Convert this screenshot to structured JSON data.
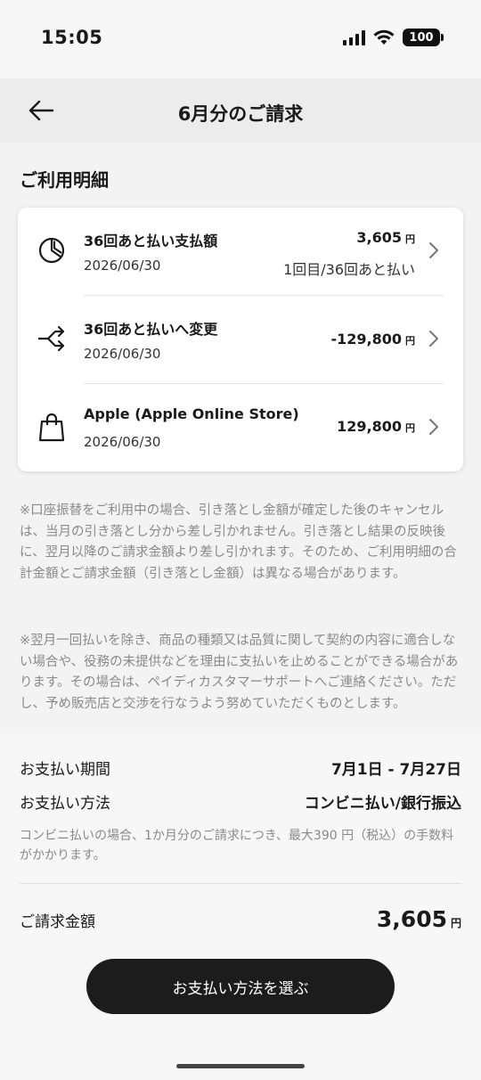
{
  "status_bar": {
    "time": "15:05",
    "battery": "100"
  },
  "header": {
    "title": "6月分のご請求"
  },
  "section": {
    "title": "ご利用明細"
  },
  "transactions": [
    {
      "name": "36回あと払い支払額",
      "date": "2026/06/30",
      "amount": "3,605",
      "currency": "円",
      "sub": "1回目/36回あと払い",
      "icon": "pie-chart-icon"
    },
    {
      "name": "36回あと払いへ変更",
      "date": "2026/06/30",
      "amount": "-129,800",
      "currency": "円",
      "icon": "split-arrow-icon"
    },
    {
      "name": "Apple (Apple Online Store)",
      "date": "2026/06/30",
      "amount": "129,800",
      "currency": "円",
      "icon": "shopping-bag-icon"
    }
  ],
  "notes": [
    "※口座振替をご利用中の場合、引き落とし金額が確定した後のキャンセルは、当月の引き落とし分から差し引かれません。引き落とし結果の反映後に、翌月以降のご請求金額より差し引かれます。そのため、ご利用明細の合計金額とご請求金額（引き落とし金額）は異なる場合があります。",
    "※翌月一回払いを除き、商品の種類又は品質に関して契約の内容に適合しない場合や、役務の未提供などを理由に支払いを止めることができる場合があります。その場合は、ペイディカスタマーサポートへご連絡ください。ただし、予め販売店と交渉を行なうよう努めていただくものとします。"
  ],
  "payment": {
    "period_label": "お支払い期間",
    "period_value": "7月1日 - 7月27日",
    "method_label": "お支払い方法",
    "method_value": "コンビニ払い/銀行振込",
    "fee_note": "コンビニ払いの場合、1か月分のご請求につき、最大390 円（税込）の手数料がかかります。",
    "total_label": "ご請求金額",
    "total_amount": "3,605",
    "total_currency": "円",
    "cta_label": "お支払い方法を選ぶ"
  }
}
